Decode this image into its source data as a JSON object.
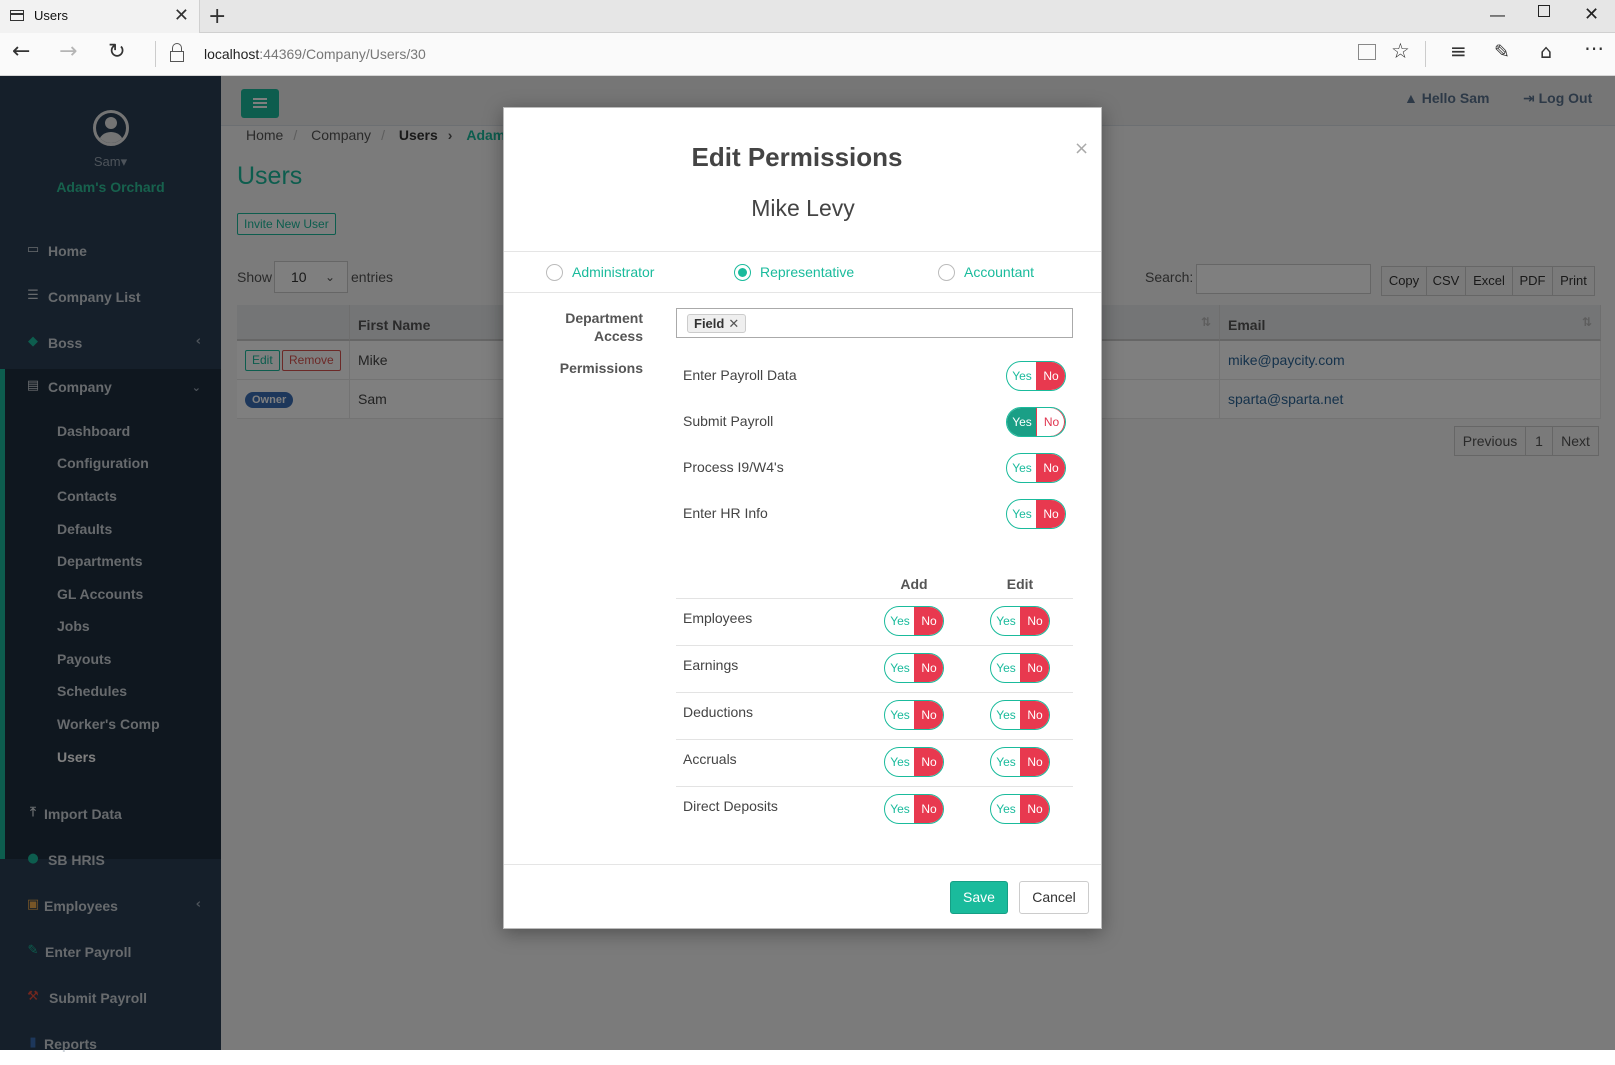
{
  "browser": {
    "tab_title": "Users",
    "close_glyph": "✕",
    "newtab_glyph": "+",
    "url_host": "localhost",
    "url_path": ":44369/Company/Users/30"
  },
  "sidebar": {
    "user_name": "Sam",
    "company_name": "Adam's Orchard",
    "menu": [
      {
        "label": "Home",
        "icon": "desktop-icon"
      },
      {
        "label": "Company List",
        "icon": "list-icon"
      },
      {
        "label": "Boss",
        "icon": "diamond-icon"
      },
      {
        "label": "Company",
        "icon": "building-icon"
      }
    ],
    "company_submenu": [
      "Dashboard",
      "Configuration",
      "Contacts",
      "Defaults",
      "Departments",
      "GL Accounts",
      "Jobs",
      "Payouts",
      "Schedules",
      "Worker's Comp",
      "Users"
    ],
    "menu_after": [
      {
        "label": "Import Data",
        "icon": "upload-icon"
      },
      {
        "label": "SB HRIS",
        "icon": "users-icon"
      },
      {
        "label": "Employees",
        "icon": "id-card-icon"
      },
      {
        "label": "Enter Payroll",
        "icon": "edit-icon"
      },
      {
        "label": "Submit Payroll",
        "icon": "gavel-icon"
      },
      {
        "label": "Reports",
        "icon": "book-icon"
      }
    ]
  },
  "topnav": {
    "hello": "Hello Sam",
    "logout": "Log Out"
  },
  "breadcrumb": [
    "Home",
    "Company",
    "Users",
    "Adam's Orchard"
  ],
  "page": {
    "title": "Users",
    "invite_button": "Invite New User",
    "show_label": "Show",
    "show_value": "10",
    "entries_label": "entries",
    "search_label": "Search:",
    "export_buttons": [
      "Copy",
      "CSV",
      "Excel",
      "PDF",
      "Print"
    ],
    "table": {
      "columns": [
        "",
        "First Name",
        "",
        "Email"
      ],
      "rows": [
        {
          "actions": [
            "Edit",
            "Remove"
          ],
          "first_name": "Mike",
          "email": "mike@paycity.com"
        },
        {
          "badge": "Owner",
          "first_name": "Sam",
          "email": "sparta@sparta.net"
        }
      ]
    },
    "pagination": [
      "Previous",
      "1",
      "Next"
    ]
  },
  "modal": {
    "title": "Edit Permissions",
    "subtitle": "Mike Levy",
    "roles": [
      {
        "label": "Administrator",
        "checked": false
      },
      {
        "label": "Representative",
        "checked": true
      },
      {
        "label": "Accountant",
        "checked": false
      }
    ],
    "department_label_1": "Department",
    "department_label_2": "Access",
    "department_tags": [
      "Field"
    ],
    "permissions_label": "Permissions",
    "toggle_yes": "Yes",
    "toggle_no": "No",
    "permissions": [
      {
        "label": "Enter Payroll Data",
        "value": "No"
      },
      {
        "label": "Submit Payroll",
        "value": "Yes"
      },
      {
        "label": "Process I9/W4's",
        "value": "No"
      },
      {
        "label": "Enter HR Info",
        "value": "No"
      }
    ],
    "grid_headers": [
      "Add",
      "Edit"
    ],
    "grid_rows": [
      {
        "label": "Employees",
        "add": "No",
        "edit": "No"
      },
      {
        "label": "Earnings",
        "add": "No",
        "edit": "No"
      },
      {
        "label": "Deductions",
        "add": "No",
        "edit": "No"
      },
      {
        "label": "Accruals",
        "add": "No",
        "edit": "No"
      },
      {
        "label": "Direct Deposits",
        "add": "No",
        "edit": "No"
      }
    ],
    "save_label": "Save",
    "cancel_label": "Cancel",
    "close_glyph": "×"
  }
}
